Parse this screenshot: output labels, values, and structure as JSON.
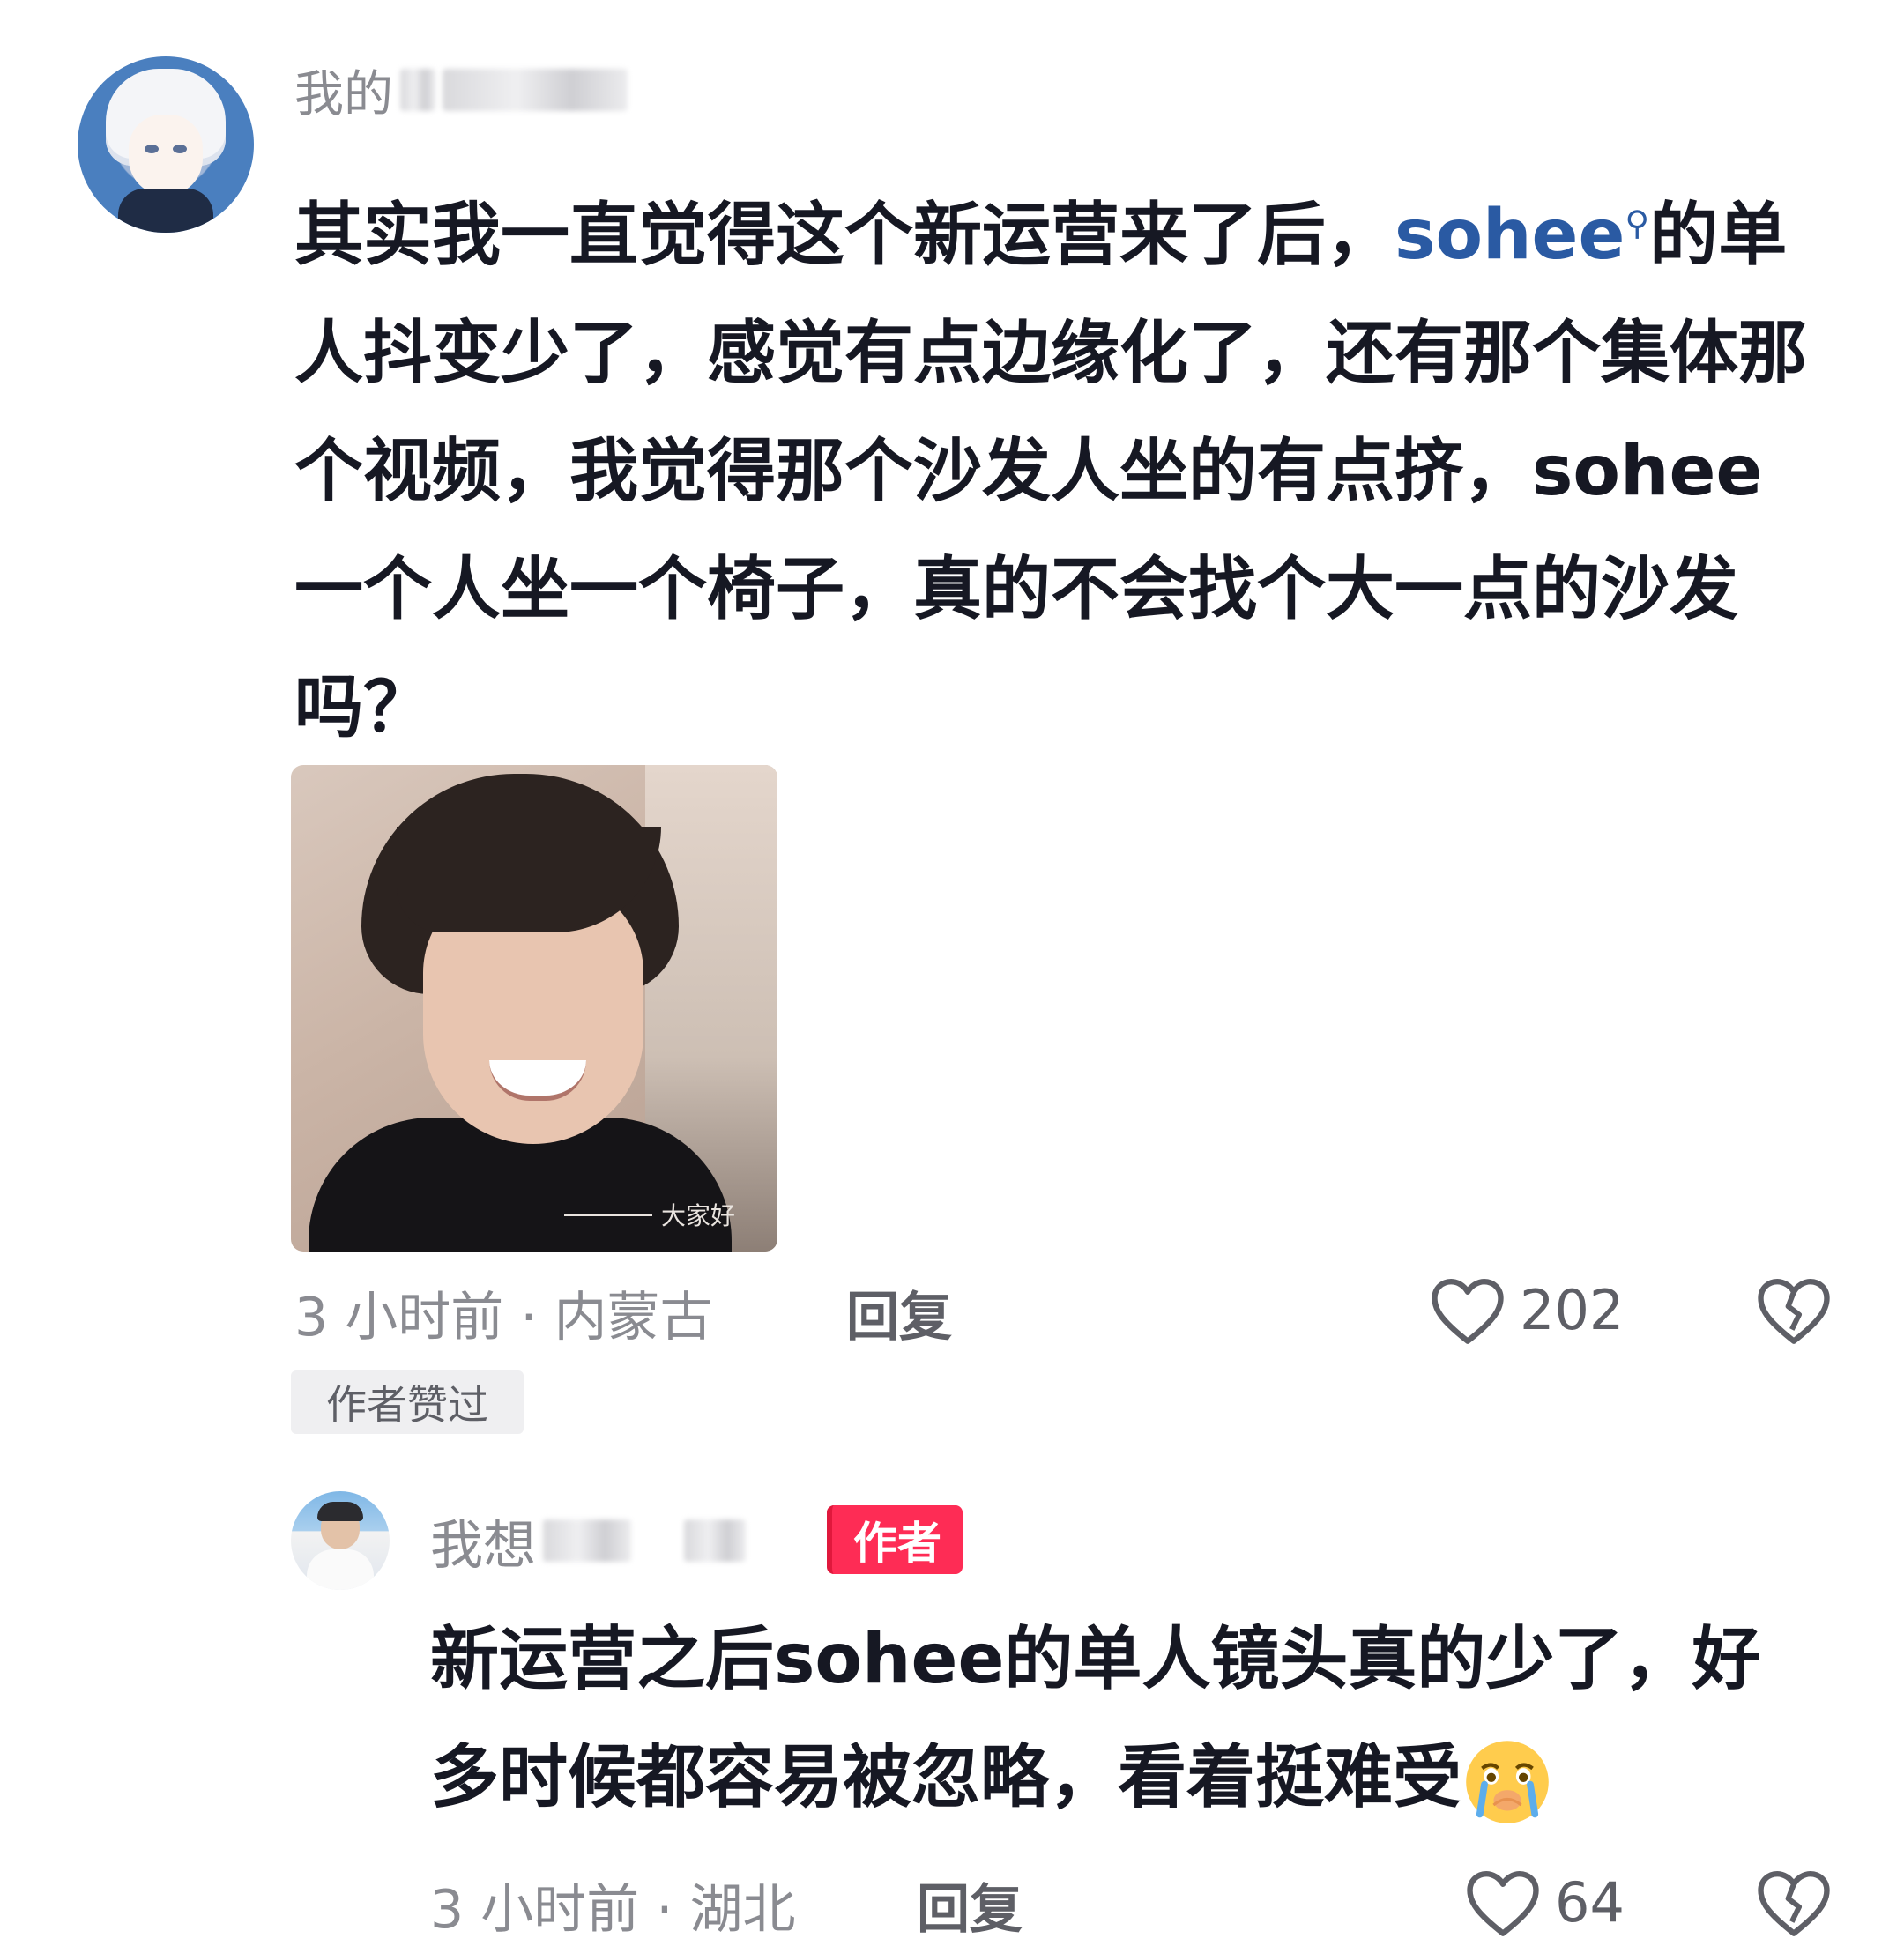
{
  "comment": {
    "username_visible": "我的",
    "text_before_link": "其实我一直觉得这个新运营来了后，",
    "link_text": "sohee",
    "search_icon": "search-icon",
    "text_after_link": "的单人抖变少了，感觉有点边缘化了，还有那个集体那个视频，我觉得那个沙发人坐的有点挤，sohee一个人坐一个椅子，真的不会找个大一点的沙发吗？",
    "image_caption": "大家好",
    "time_location": "3 小时前 · 内蒙古",
    "reply_label": "回复",
    "like_count": "202",
    "author_liked_tag": "作者赞过"
  },
  "reply": {
    "username_visible": "我想",
    "author_badge": "作者",
    "text": "新运营之后sohee的单人镜头真的少了，好多时候都容易被忽略，看着挺难受",
    "emoji": "crying-face-emoji",
    "time_location": "3 小时前 · 湖北",
    "reply_label": "回复",
    "like_count": "64"
  },
  "colors": {
    "link": "#2a5aa3",
    "author_badge": "#fe2c55",
    "meta_gray": "#8a8b91"
  }
}
